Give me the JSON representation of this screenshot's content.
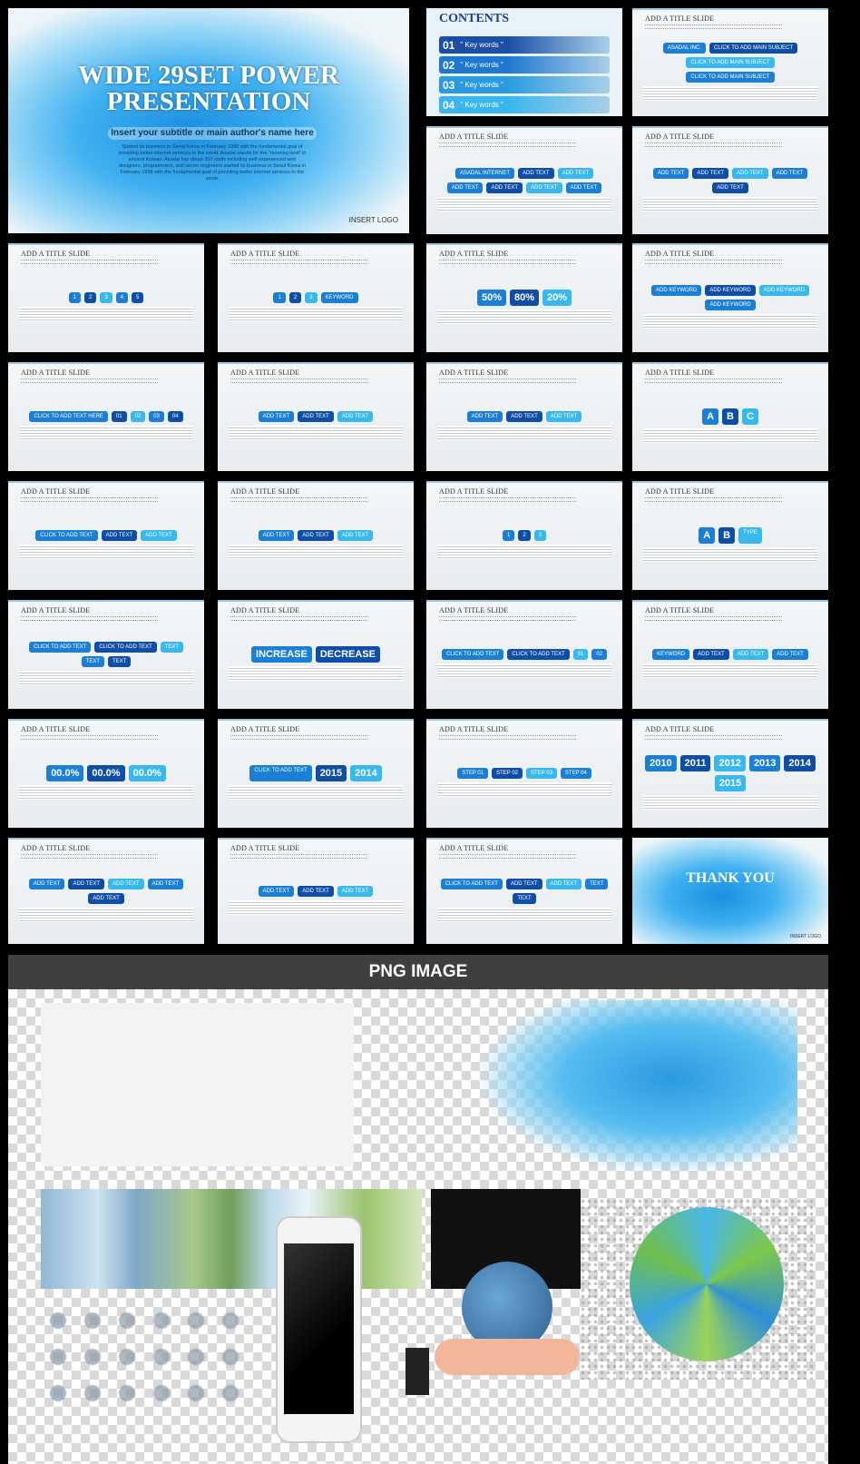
{
  "title_slide": {
    "title": "WIDE 29SET POWER PRESENTATION",
    "subtitle": "Insert your subtitle or main author's name here",
    "description": "Started its business in Seoul Korea in February 1998 with the fundamental goal of providing better internet services to the world. Asadal stands for the \"morning land\" in ancient Korean. Asadal has about 350 staffs including well experienced web designers, programmers, and server engineers started its business in Seoul Korea in February 1998 with the fundamental goal of providing better internet services to the world.",
    "logo": "INSERT LOGO"
  },
  "contents_slide": {
    "title": "CONTENTS",
    "items": [
      {
        "num": "01",
        "label": "\" Key words \""
      },
      {
        "num": "02",
        "label": "\" Key words \""
      },
      {
        "num": "03",
        "label": "\" Key words \""
      },
      {
        "num": "04",
        "label": "\" Key words \""
      }
    ],
    "colors": [
      "#1b4fa5",
      "#1f78cf",
      "#2a9be0",
      "#39b6ee"
    ]
  },
  "slides": [
    {
      "title": "ADD A TITLE SLIDE",
      "labels": [
        "ASADAL INC.",
        "CLICK TO ADD MAIN SUBJECT",
        "CLICK TO ADD MAIN SUBJECT",
        "CLICK TO ADD MAIN SUBJECT"
      ]
    },
    {
      "title": "ADD A TITLE SLIDE",
      "labels": [
        "ASADAL INTERNET",
        "ADD TEXT",
        "ADD TEXT",
        "ADD TEXT",
        "ADD TEXT",
        "ADD TEXT",
        "ADD TEXT"
      ]
    },
    {
      "title": "ADD A TITLE SLIDE",
      "labels": [
        "ADD TEXT",
        "ADD TEXT",
        "ADD TEXT",
        "ADD TEXT",
        "ADD TEXT"
      ]
    },
    {
      "title": "ADD A TITLE SLIDE",
      "labels": [
        "1",
        "2",
        "3",
        "4",
        "5"
      ]
    },
    {
      "title": "ADD A TITLE SLIDE",
      "labels": [
        "1",
        "2",
        "3",
        "KEYWORD"
      ]
    },
    {
      "title": "ADD A TITLE SLIDE",
      "labels": [
        "50%",
        "80%",
        "20%"
      ]
    },
    {
      "title": "ADD A TITLE SLIDE",
      "labels": [
        "ADD KEYWORD",
        "ADD KEYWORD",
        "ADD KEYWORD",
        "ADD KEYWORD"
      ]
    },
    {
      "title": "ADD A TITLE SLIDE",
      "labels": [
        "CLICK TO ADD TEXT HERE",
        "01",
        "02",
        "03",
        "04"
      ]
    },
    {
      "title": "ADD A TITLE SLIDE",
      "labels": [
        "ADD TEXT",
        "ADD TEXT",
        "ADD TEXT"
      ]
    },
    {
      "title": "ADD A TITLE SLIDE",
      "labels": [
        "ADD TEXT",
        "ADD TEXT",
        "ADD TEXT"
      ]
    },
    {
      "title": "ADD A TITLE SLIDE",
      "labels": [
        "A",
        "B",
        "C"
      ]
    },
    {
      "title": "ADD A TITLE SLIDE",
      "labels": [
        "CLICK TO ADD TEXT",
        "ADD TEXT",
        "ADD TEXT"
      ]
    },
    {
      "title": "ADD A TITLE SLIDE",
      "labels": [
        "ADD TEXT",
        "ADD TEXT",
        "ADD TEXT"
      ]
    },
    {
      "title": "ADD A TITLE SLIDE",
      "labels": [
        "1",
        "2",
        "3"
      ]
    },
    {
      "title": "ADD A TITLE SLIDE",
      "labels": [
        "A",
        "B",
        "TYPE"
      ]
    },
    {
      "title": "ADD A TITLE SLIDE",
      "labels": [
        "CLICK TO ADD TEXT",
        "CLICK TO ADD TEXT",
        "TEXT",
        "TEXT",
        "TEXT"
      ]
    },
    {
      "title": "ADD A TITLE SLIDE",
      "labels": [
        "INCREASE",
        "DECREASE"
      ]
    },
    {
      "title": "ADD A TITLE SLIDE",
      "labels": [
        "CLICK TO ADD TEXT",
        "CLICK TO ADD TEXT",
        "01",
        "02"
      ]
    },
    {
      "title": "ADD A TITLE SLIDE",
      "labels": [
        "KEYWORD",
        "ADD TEXT",
        "ADD TEXT",
        "ADD TEXT"
      ]
    },
    {
      "title": "ADD A TITLE SLIDE",
      "labels": [
        "00.0%",
        "00.0%",
        "00.0%"
      ]
    },
    {
      "title": "ADD A TITLE SLIDE",
      "labels": [
        "CLICK TO ADD TEXT",
        "2015",
        "2014"
      ]
    },
    {
      "title": "ADD A TITLE SLIDE",
      "labels": [
        "STEP 01",
        "STEP 02",
        "STEP 03",
        "STEP 04"
      ]
    },
    {
      "title": "ADD A TITLE SLIDE",
      "labels": [
        "2010",
        "2011",
        "2012",
        "2013",
        "2014",
        "2015"
      ]
    },
    {
      "title": "ADD A TITLE SLIDE",
      "labels": [
        "ADD TEXT",
        "ADD TEXT",
        "ADD TEXT",
        "ADD TEXT",
        "ADD TEXT"
      ]
    },
    {
      "title": "ADD A TITLE SLIDE",
      "labels": [
        "ADD TEXT",
        "ADD TEXT",
        "ADD TEXT"
      ]
    },
    {
      "title": "ADD A TITLE SLIDE",
      "labels": [
        "CLICK TO ADD TEXT",
        "ADD TEXT",
        "ADD TEXT",
        "TEXT",
        "TEXT"
      ]
    }
  ],
  "thank_you": {
    "title": "THANK YOU",
    "logo": "INSERT LOGO"
  },
  "png_section": {
    "header": "PNG IMAGE"
  }
}
